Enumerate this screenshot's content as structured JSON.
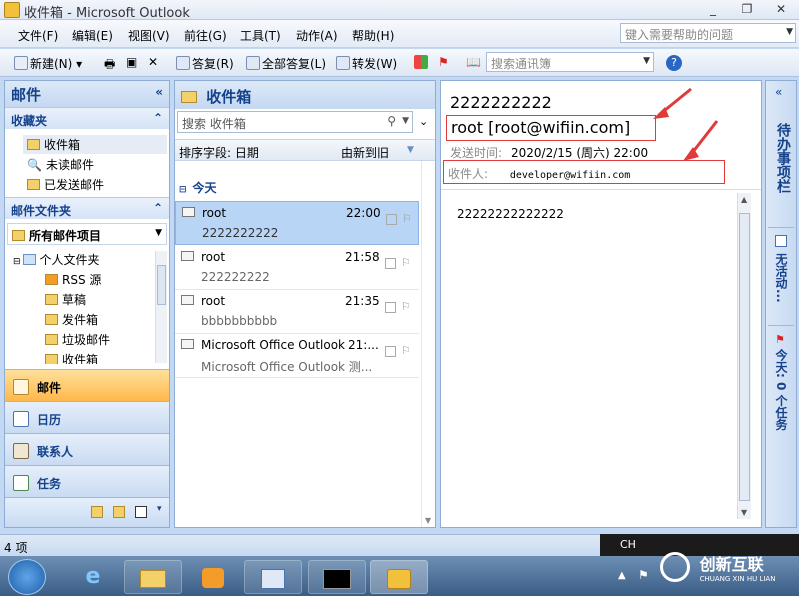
{
  "window": {
    "title": "收件箱 - Microsoft Outlook",
    "min": "_",
    "max": "❐",
    "close": "✕"
  },
  "menu": [
    "文件(F)",
    "编辑(E)",
    "视图(V)",
    "前往(G)",
    "工具(T)",
    "动作(A)",
    "帮助(H)"
  ],
  "help_placeholder": "键入需要帮助的问题",
  "toolbar": {
    "new": "新建(N)",
    "reply": "答复(R)",
    "reply_all": "全部答复(L)",
    "forward": "转发(W)",
    "contact_search": "搜索通讯簿"
  },
  "nav": {
    "title": "邮件",
    "favorites_title": "收藏夹",
    "favorites": [
      "收件箱",
      "未读邮件",
      "已发送邮件"
    ],
    "folders_title": "邮件文件夹",
    "all_items": "所有邮件项目",
    "tree_root": "个人文件夹",
    "tree": [
      "RSS 源",
      "草稿",
      "发件箱",
      "垃圾邮件",
      "收件箱"
    ],
    "buttons": [
      "邮件",
      "日历",
      "联系人",
      "任务"
    ]
  },
  "list": {
    "title": "收件箱",
    "search_placeholder": "搜索 收件箱",
    "sort_label": "排序字段: 日期",
    "sort_order": "由新到旧",
    "group": "今天",
    "messages": [
      {
        "sender": "root",
        "time": "22:00",
        "preview": "2222222222"
      },
      {
        "sender": "root",
        "time": "21:58",
        "preview": "222222222"
      },
      {
        "sender": "root",
        "time": "21:35",
        "preview": "bbbbbbbbbb"
      },
      {
        "sender": "Microsoft Office Outlook",
        "time": "21:...",
        "preview": "Microsoft Office Outlook 测..."
      }
    ]
  },
  "reading": {
    "subject": "2222222222",
    "from": "root [root@wifiin.com]",
    "sent_label": "发送时间:",
    "sent_value": "2020/2/15 (周六) 22:00",
    "to_label": "收件人:",
    "to_value": "developer@wifiin.com",
    "body": "22222222222222"
  },
  "todo": {
    "title": "待办事项栏",
    "no_appt": "无活动...",
    "tasks": "今天: 0 个任务"
  },
  "status": {
    "items": "4 项",
    "lang": "CH"
  },
  "watermark": {
    "name": "创新互联",
    "sub": "CHUANG XIN HU LIAN"
  },
  "colors": {
    "accent": "#15428b",
    "selected": "#b8d5f5",
    "annotation_red": "#e03a3a",
    "active_nav": "#ffb84a"
  }
}
